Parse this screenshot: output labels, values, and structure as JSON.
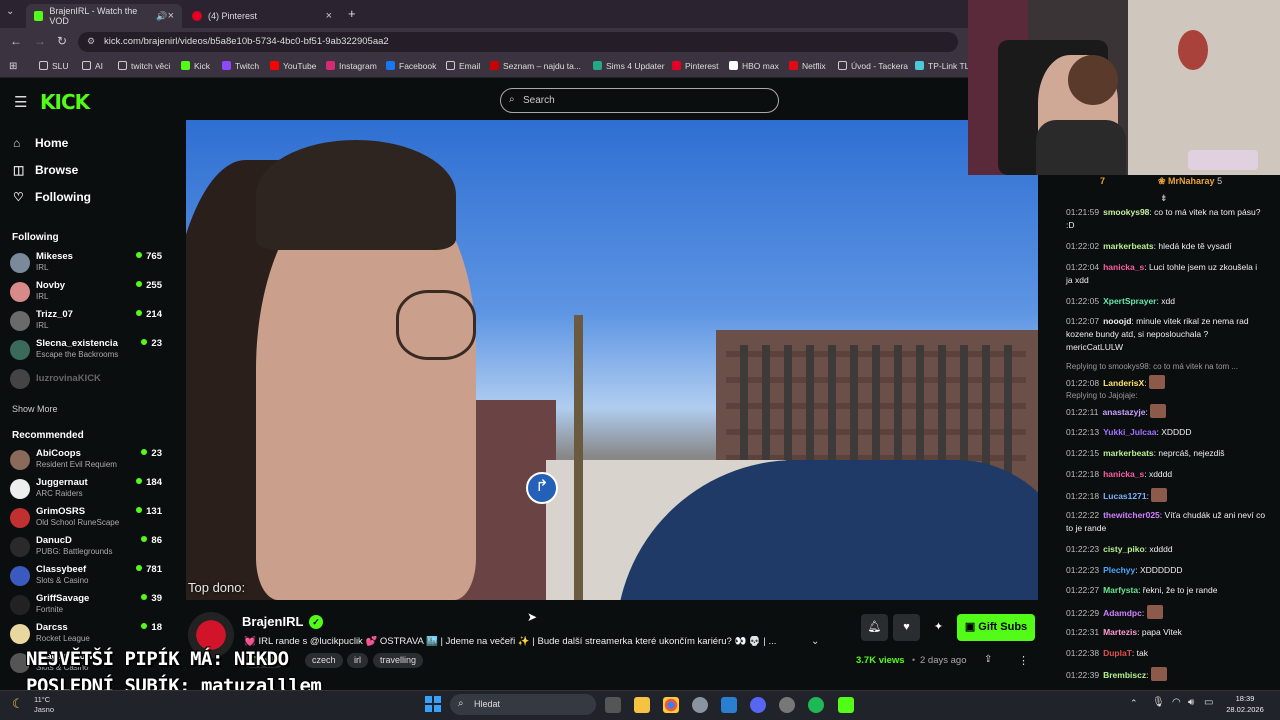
{
  "browser": {
    "tabs": [
      {
        "label": "BrajenIRL - Watch the VOD",
        "active": true
      },
      {
        "label": "(4) Pinterest",
        "active": false
      }
    ],
    "url": "kick.com/brajenirl/videos/b5a8e10b-5734-4bc0-bf51-9ab322905aa2",
    "bookmarks": [
      "SLU",
      "AI",
      "twitch věci",
      "Kick",
      "Twitch",
      "YouTube",
      "Instagram",
      "Facebook",
      "Email",
      "Seznam – najdu ta...",
      "Sims 4 Updater",
      "Pinterest",
      "HBO max",
      "Netflix",
      "Úvod - Tackera",
      "TP-Link TL"
    ]
  },
  "header": {
    "logo": "KICK",
    "search_placeholder": "Search"
  },
  "sidebar": {
    "nav": [
      {
        "label": "Home",
        "icon": "home-icon"
      },
      {
        "label": "Browse",
        "icon": "browse-icon"
      },
      {
        "label": "Following",
        "icon": "heart-icon"
      }
    ],
    "following_title": "Following",
    "following": [
      {
        "name": "Mikeses",
        "category": "IRL",
        "viewers": "765",
        "color": "#7a8a9a"
      },
      {
        "name": "Novby",
        "category": "IRL",
        "viewers": "255",
        "color": "#d88a8a"
      },
      {
        "name": "Trizz_07",
        "category": "IRL",
        "viewers": "214",
        "color": "#6a6a6a"
      },
      {
        "name": "Slecna_existencia",
        "category": "Escape the Backrooms",
        "viewers": "23",
        "color": "#3a6a5a"
      },
      {
        "name": "luzrovinaKICK",
        "category": "",
        "viewers": "",
        "color": "#444"
      }
    ],
    "show_more": "Show More",
    "recommended_title": "Recommended",
    "recommended": [
      {
        "name": "AbiCoops",
        "category": "Resident Evil Requiem",
        "viewers": "23",
        "color": "#8a6a5a"
      },
      {
        "name": "Juggernaut",
        "category": "ARC Raiders",
        "viewers": "184",
        "color": "#eeeeee"
      },
      {
        "name": "GrimOSRS",
        "category": "Old School RuneScape",
        "viewers": "131",
        "color": "#c03030"
      },
      {
        "name": "DanucD",
        "category": "PUBG: Battlegrounds",
        "viewers": "86",
        "color": "#2a2a2a"
      },
      {
        "name": "Classybeef",
        "category": "Slots & Casino",
        "viewers": "781",
        "color": "#3a5ac0"
      },
      {
        "name": "GriffSavage",
        "category": "Fortnite",
        "viewers": "39",
        "color": "#222"
      },
      {
        "name": "Darcss",
        "category": "Rocket League",
        "viewers": "18",
        "color": "#e8d8a0"
      },
      {
        "name": "Teagueshow",
        "category": "Slots & Casino",
        "viewers": "",
        "color": "#555"
      }
    ]
  },
  "video": {
    "overlay_text": "Top dono:",
    "channel": "BrajenIRL",
    "title": "💓 IRL rande s @lucikpuclik 💕 OSTRAVA 🏙️ | Jdeme na večeři ✨ | Bude další streamerka které ukončím kariéru? 👀 💀 | ...",
    "tags": [
      "Czech",
      "czech",
      "irl",
      "travelling"
    ],
    "views": "3.7K views",
    "age": "2 days ago",
    "gift_subs": "Gift Subs",
    "stream_overlay_line1": "NEJVĚTŠÍ PIPÍK MÁ: NIKDO",
    "stream_overlay_line2": "POSLEDNÍ SUBÍK: matuzalllem"
  },
  "chat": {
    "top_gifter": "MrNaharay",
    "top_gifter_count": "5",
    "top_count_left": "7",
    "messages": [
      {
        "time": "01:21:59",
        "user": "smookys98",
        "color": "#c8f0a0",
        "text": "co to má vitek na tom pásu? :D"
      },
      {
        "time": "01:22:02",
        "user": "markerbeats",
        "color": "#b8f090",
        "text": "hledá kde tě vysadí"
      },
      {
        "time": "01:22:04",
        "user": "hanicka_s",
        "color": "#ff5ca8",
        "text": "Luci tohle jsem uz zkoušela i ja xdd"
      },
      {
        "time": "01:22:05",
        "user": "XpertSprayer",
        "color": "#66e8b0",
        "text": "xdd"
      },
      {
        "time": "01:22:07",
        "user": "nooojd",
        "color": "#f0f0f0",
        "text": "minule vitek rikal ze nema rad kozene bundy atd, si neposlouchala ? mericCatLULW"
      },
      {
        "time": "01:22:08",
        "user": "LanderisX",
        "color": "#ffe36a",
        "text": "",
        "reply": "Replying to smookys98: co to má vitek na tom ..."
      },
      {
        "time": "01:22:11",
        "user": "anastazyje",
        "color": "#c8a0ff",
        "text": "",
        "reply": "Replying to Jajojaje:"
      },
      {
        "time": "01:22:13",
        "user": "Yukki_Julcaa",
        "color": "#a070ff",
        "text": "XDDDD"
      },
      {
        "time": "01:22:15",
        "user": "markerbeats",
        "color": "#b8f090",
        "text": "neprcáš, nejezdiš"
      },
      {
        "time": "01:22:18",
        "user": "hanicka_s",
        "color": "#ff5ca8",
        "text": "xdddd"
      },
      {
        "time": "01:22:18",
        "user": "Lucas1271",
        "color": "#7ab0ff",
        "text": ""
      },
      {
        "time": "01:22:22",
        "user": "thewitcher025",
        "color": "#d080ff",
        "text": "Víťa chudák už ani neví co to je rande"
      },
      {
        "time": "01:22:23",
        "user": "cisty_piko",
        "color": "#b8f090",
        "text": "xdddd"
      },
      {
        "time": "01:22:23",
        "user": "Plechyy",
        "color": "#4aa8ff",
        "text": "XDDDDDD"
      },
      {
        "time": "01:22:27",
        "user": "Marfysta",
        "color": "#66e890",
        "text": "řekni, že to je rande"
      },
      {
        "time": "01:22:29",
        "user": "Adamdpc",
        "color": "#d080ff",
        "text": ""
      },
      {
        "time": "01:22:31",
        "user": "Martezis",
        "color": "#ff9ad0",
        "text": "papa Vitek"
      },
      {
        "time": "01:22:38",
        "user": "DuplaT",
        "color": "#e05050",
        "text": "tak"
      },
      {
        "time": "01:22:39",
        "user": "Brembiscz",
        "color": "#b8f090",
        "text": ""
      }
    ]
  },
  "taskbar": {
    "search": "Hledat",
    "weather_temp": "11°C",
    "weather_text": "Jasno",
    "time": "18:39",
    "date": "28.02.2026"
  }
}
